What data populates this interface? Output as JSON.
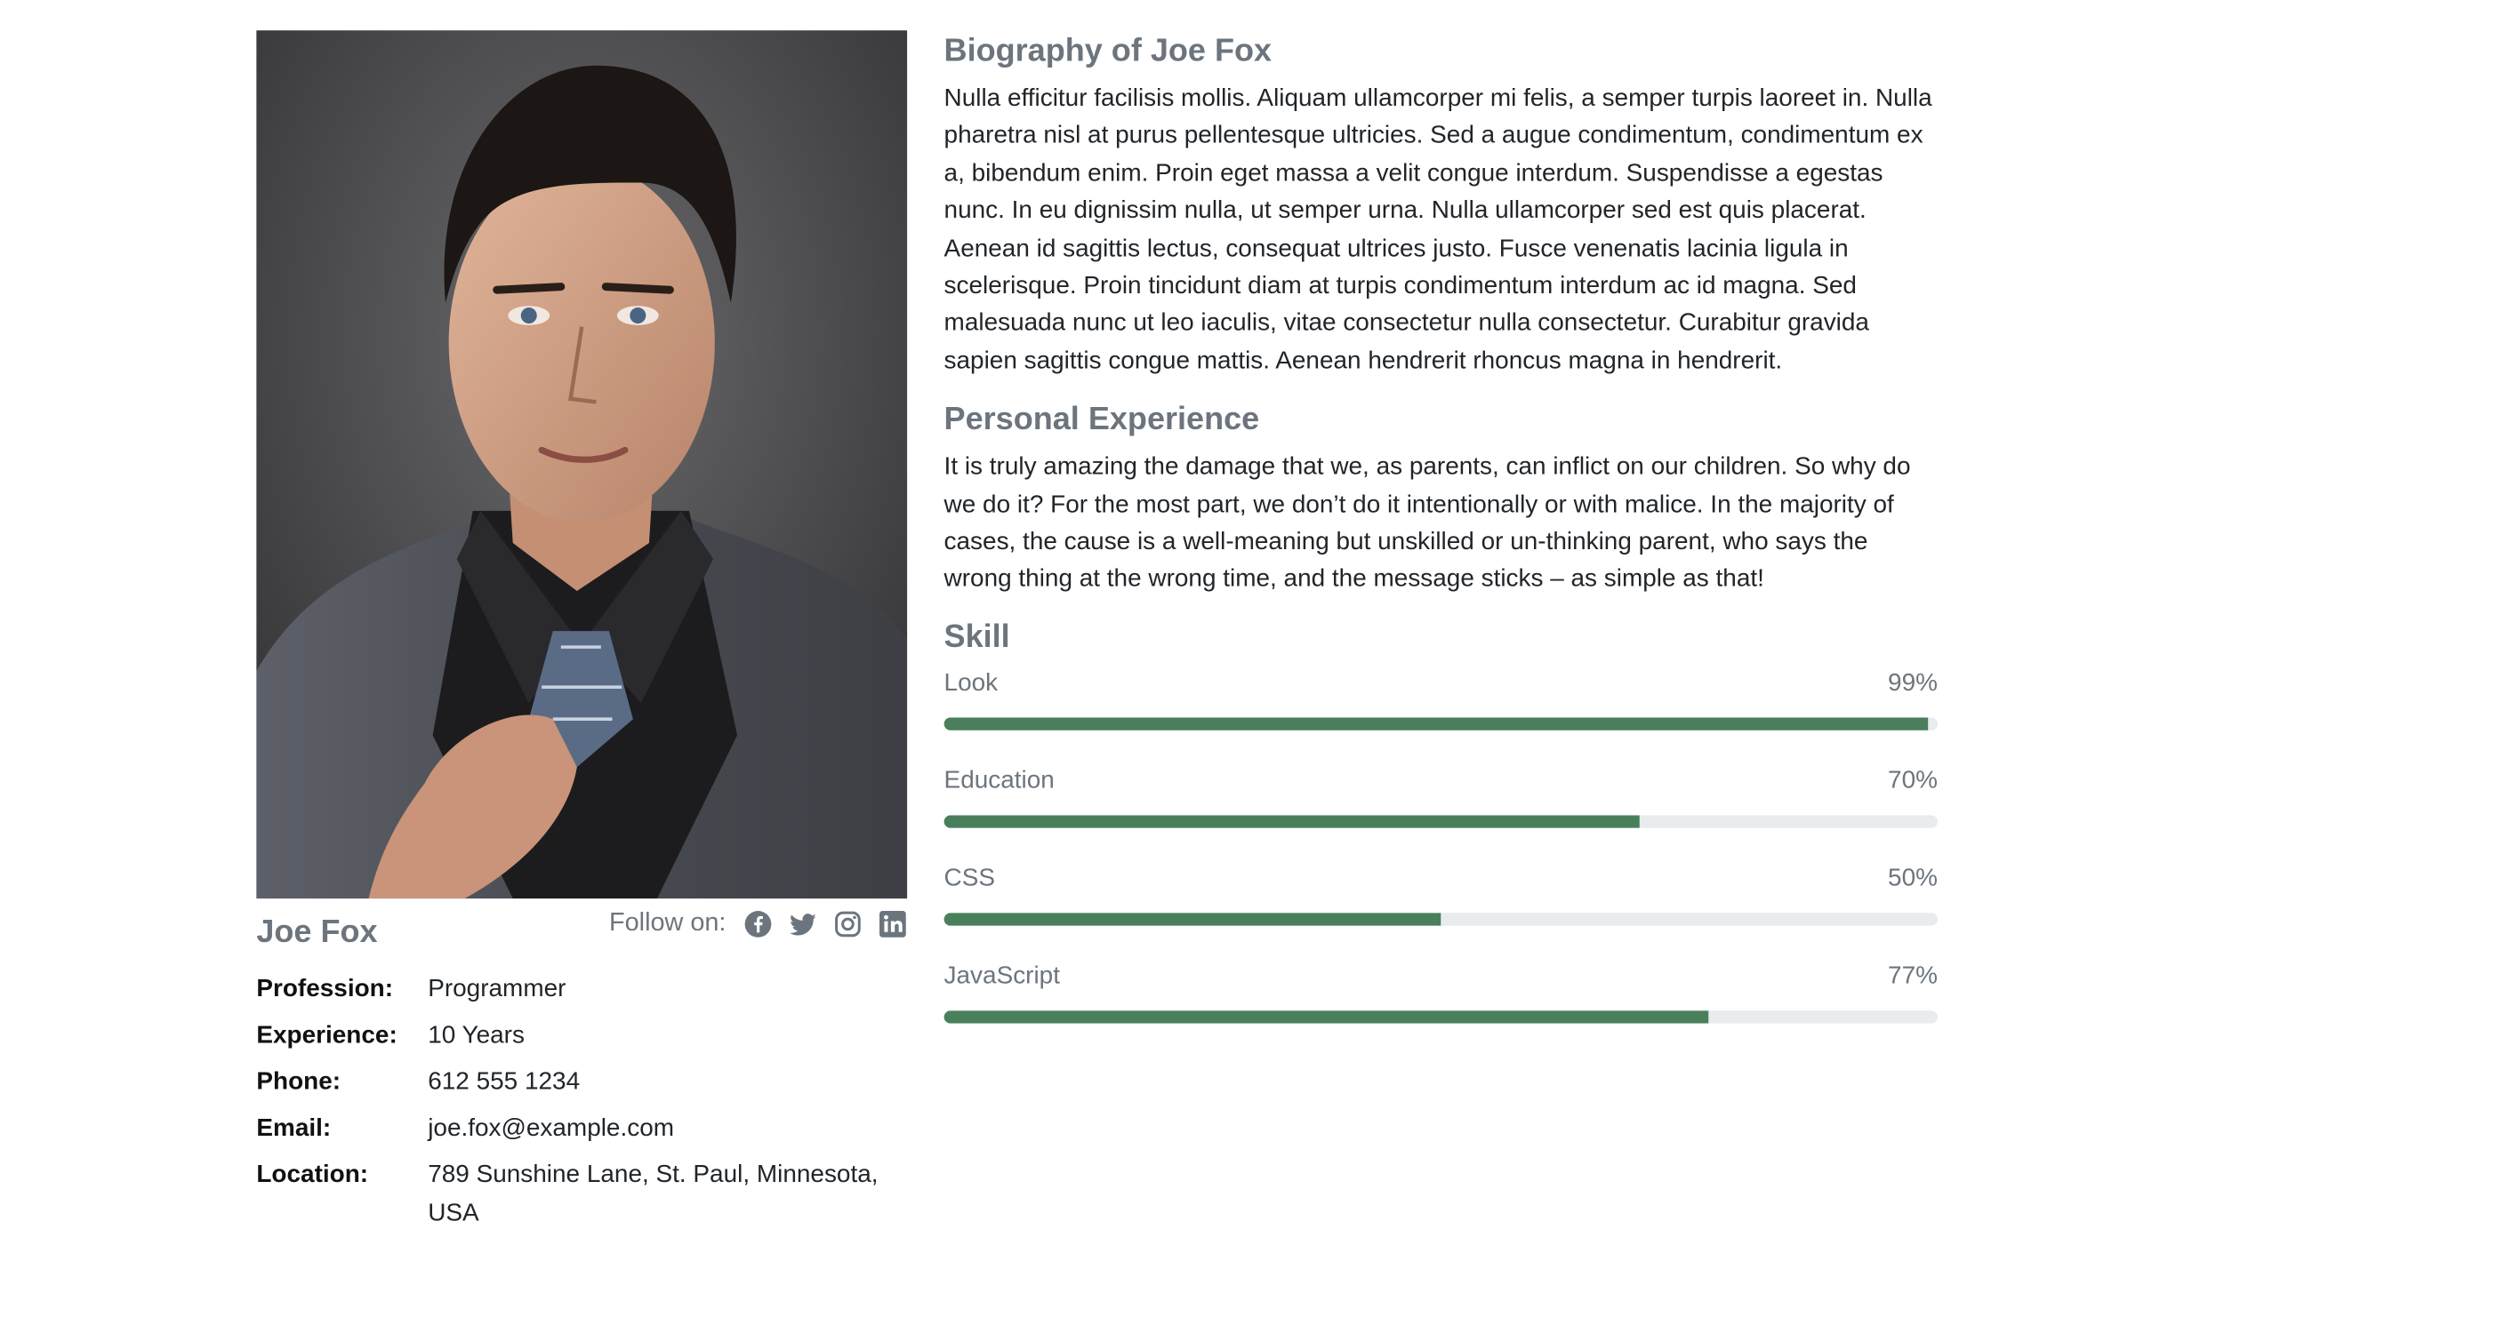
{
  "profile": {
    "name": "Joe Fox",
    "photo_alt": "Joe Fox",
    "follow_label": "Follow on:",
    "social": [
      "facebook-icon",
      "twitter-icon",
      "instagram-icon",
      "linkedin-icon"
    ],
    "info": [
      {
        "key": "Profession:",
        "value": "Programmer"
      },
      {
        "key": "Experience:",
        "value": "10 Years"
      },
      {
        "key": "Phone:",
        "value": "612 555 1234"
      },
      {
        "key": "Email:",
        "value": "joe.fox@example.com"
      },
      {
        "key": "Location:",
        "value": "789 Sunshine Lane, St. Paul, Minnesota, USA"
      }
    ]
  },
  "biography": {
    "title": "Biography of Joe Fox",
    "text": "Nulla efficitur facilisis mollis. Aliquam ullamcorper mi felis, a semper turpis laoreet in. Nulla pharetra nisl at purus pellentesque ultricies. Sed a augue condimentum, condimentum ex a, bibendum enim. Proin eget massa a velit congue interdum. Suspendisse a egestas nunc. In eu dignissim nulla, ut semper urna. Nulla ullamcorper sed est quis placerat. Aenean id sagittis lectus, consequat ultrices justo. Fusce venenatis lacinia ligula in scelerisque. Proin tincidunt diam at turpis condimentum interdum ac id magna. Sed malesuada nunc ut leo iaculis, vitae consectetur nulla consectetur. Curabitur gravida sapien sagittis congue mattis. Aenean hendrerit rhoncus magna in hendrerit."
  },
  "experience": {
    "title": "Personal Experience",
    "text": "It is truly amazing the damage that we, as parents, can inflict on our children. So why do we do it? For the most part, we don’t do it intentionally or with malice. In the majority of cases, the cause is a well-meaning but unskilled or un-thinking parent, who says the wrong thing at the wrong time, and the message sticks – as simple as that!"
  },
  "skills": {
    "title": "Skill",
    "items": [
      {
        "label": "Look",
        "value": 99,
        "display": "99%"
      },
      {
        "label": "Education",
        "value": 70,
        "display": "70%"
      },
      {
        "label": "CSS",
        "value": 50,
        "display": "50%"
      },
      {
        "label": "JavaScript",
        "value": 77,
        "display": "77%"
      }
    ]
  },
  "colors": {
    "bar_fill": "#4a7f5c",
    "bar_track": "#e9ecef",
    "muted_text": "#6c757d"
  }
}
